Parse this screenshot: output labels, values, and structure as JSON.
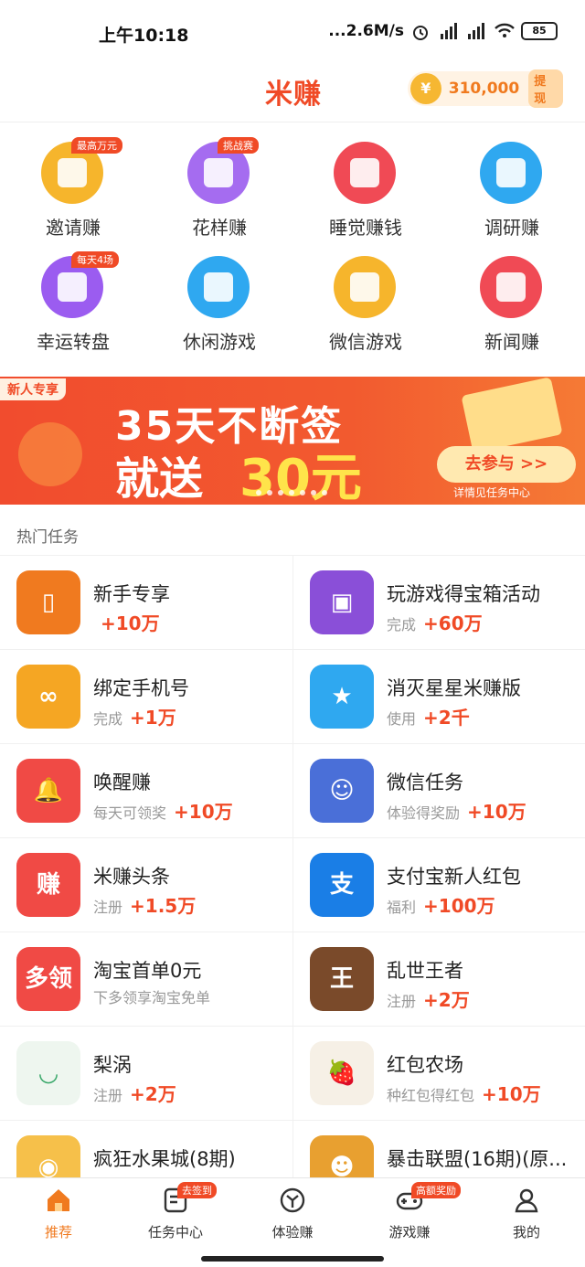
{
  "status_bar": {
    "time": "上午10:18",
    "network_speed": "...2.6M/s",
    "battery": "85"
  },
  "header": {
    "logo": "米赚",
    "coin_amount": "310,000",
    "coin_button": "提现",
    "coin_icon": "coin-icon"
  },
  "grid": [
    {
      "label": "邀请赚",
      "badge": "最高万元",
      "color": "#f6b52c",
      "icon": "envelope-icon"
    },
    {
      "label": "花样赚",
      "badge": "挑战赛",
      "color": "#a56cf0",
      "icon": "alarm-icon"
    },
    {
      "label": "睡觉赚钱",
      "badge": "",
      "color": "#f04a55",
      "icon": "pig-icon"
    },
    {
      "label": "调研赚",
      "badge": "",
      "color": "#2fa8f0",
      "icon": "document-icon"
    },
    {
      "label": "幸运转盘",
      "badge": "每天4场",
      "color": "#9b5cf0",
      "icon": "wheel-icon"
    },
    {
      "label": "休闲游戏",
      "badge": "",
      "color": "#2fa8f0",
      "icon": "cup-icon"
    },
    {
      "label": "微信游戏",
      "badge": "",
      "color": "#f6b52c",
      "icon": "gamepad-icon"
    },
    {
      "label": "新闻赚",
      "badge": "",
      "color": "#f04a55",
      "icon": "newspaper-icon"
    }
  ],
  "banner": {
    "tag": "新人专享",
    "line1": "35天不断签",
    "line2_pre": "就送",
    "line2_amount": "30元",
    "button": "去参与 >>",
    "note": "详情见任务中心"
  },
  "section_title": "热门任务",
  "tasks": [
    {
      "title": "新手专享",
      "status": "",
      "reward": "+10万",
      "color": "#f07a1f",
      "glyph": "▯",
      "icon": "phone-hand-icon"
    },
    {
      "title": "玩游戏得宝箱活动",
      "status": "完成",
      "reward": "+60万",
      "color": "#8a4fd8",
      "glyph": "▣",
      "icon": "treasure-chest-icon"
    },
    {
      "title": "绑定手机号",
      "status": "完成",
      "reward": "+1万",
      "color": "#f5a623",
      "glyph": "∞",
      "icon": "phone-link-icon"
    },
    {
      "title": "消灭星星米赚版",
      "status": "使用",
      "reward": "+2千",
      "color": "#2fa8f0",
      "glyph": "★",
      "icon": "star-game-icon"
    },
    {
      "title": "唤醒赚",
      "status": "每天可领奖",
      "reward": "+10万",
      "color": "#f04a45",
      "glyph": "🔔",
      "icon": "bell-icon"
    },
    {
      "title": "微信任务",
      "status": "体验得奖励",
      "reward": "+10万",
      "color": "#4a6fd8",
      "glyph": "☺",
      "icon": "wechat-task-icon"
    },
    {
      "title": "米赚头条",
      "status": "注册",
      "reward": "+1.5万",
      "color": "#f04a45",
      "glyph": "赚",
      "icon": "headline-icon"
    },
    {
      "title": "支付宝新人红包",
      "status": "福利",
      "reward": "+100万",
      "color": "#1a7ee6",
      "glyph": "支",
      "icon": "alipay-icon"
    },
    {
      "title": "淘宝首单0元",
      "status": "下多领享淘宝免单",
      "reward": "",
      "color": "#f04a45",
      "glyph": "多领",
      "icon": "taobao-icon"
    },
    {
      "title": "乱世王者",
      "status": "注册",
      "reward": "+2万",
      "color": "#7a4a2a",
      "glyph": "王",
      "icon": "game-avatar-icon"
    },
    {
      "title": "梨涡",
      "status": "注册",
      "reward": "+2万",
      "color": "#eef6ef",
      "glyph": "◡",
      "icon": "liwo-icon"
    },
    {
      "title": "红包农场",
      "status": "种红包得红包",
      "reward": "+10万",
      "color": "#f6f0e6",
      "glyph": "🍓",
      "icon": "farm-icon"
    },
    {
      "title": "疯狂水果城(8期)",
      "status": "",
      "reward": "",
      "color": "#f6c04a",
      "glyph": "◉",
      "icon": "fruit-game-icon"
    },
    {
      "title": "暴击联盟(16期)(原...",
      "status": "",
      "reward": "",
      "color": "#e8a030",
      "glyph": "☻",
      "icon": "hero-game-icon"
    }
  ],
  "bottom_nav": [
    {
      "label": "推荐",
      "badge": "",
      "icon": "home-icon",
      "active": true
    },
    {
      "label": "任务中心",
      "badge": "去签到",
      "icon": "task-list-icon",
      "active": false
    },
    {
      "label": "体验赚",
      "badge": "",
      "icon": "experience-icon",
      "active": false
    },
    {
      "label": "游戏赚",
      "badge": "高额奖励",
      "icon": "gamepad-nav-icon",
      "active": false
    },
    {
      "label": "我的",
      "badge": "",
      "icon": "user-icon",
      "active": false
    }
  ]
}
